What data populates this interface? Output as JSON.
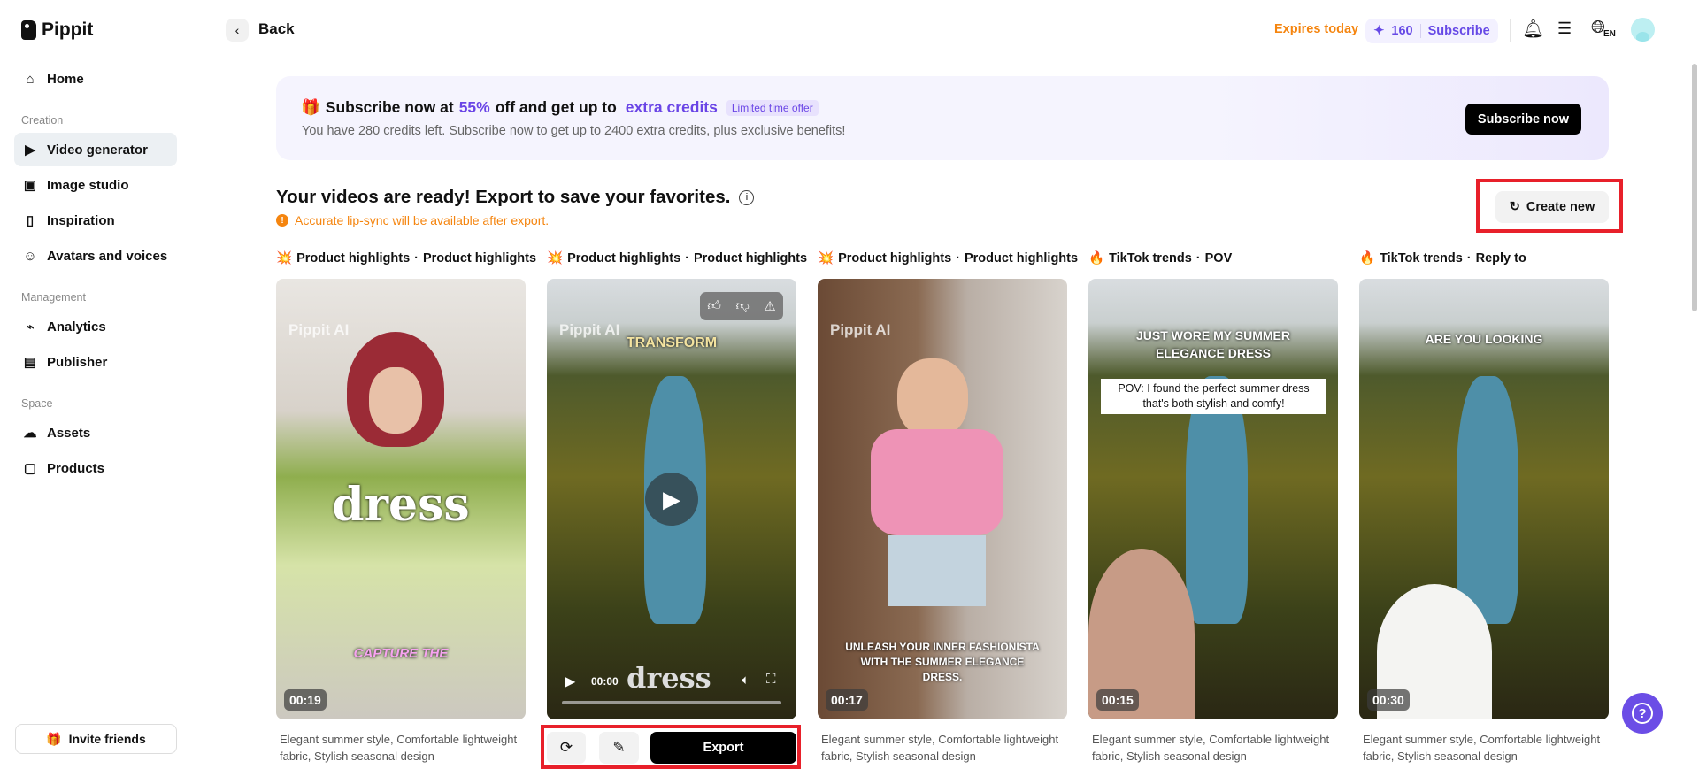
{
  "app": {
    "name": "Pippit"
  },
  "sidebar": {
    "home": "Home",
    "sections": [
      {
        "label": "Creation",
        "items": [
          {
            "label": "Video generator",
            "icon": "video-plus-icon",
            "active": true
          },
          {
            "label": "Image studio",
            "icon": "image-plus-icon"
          },
          {
            "label": "Inspiration",
            "icon": "inspiration-icon"
          },
          {
            "label": "Avatars and voices",
            "icon": "avatar-icon"
          }
        ]
      },
      {
        "label": "Management",
        "items": [
          {
            "label": "Analytics",
            "icon": "chart-icon"
          },
          {
            "label": "Publisher",
            "icon": "calendar-icon"
          }
        ]
      },
      {
        "label": "Space",
        "items": [
          {
            "label": "Assets",
            "icon": "cloud-icon"
          },
          {
            "label": "Products",
            "icon": "box-icon"
          }
        ]
      }
    ],
    "invite": "Invite friends"
  },
  "header": {
    "back": "Back",
    "expires": "Expires today",
    "credits": "160",
    "subscribe": "Subscribe",
    "lang": "EN"
  },
  "banner": {
    "t1": "Subscribe now at",
    "pct": "55%",
    "t2": "off and get up to",
    "extra": "extra credits",
    "badge": "Limited time offer",
    "sub": "You have 280 credits left. Subscribe now to get up to 2400 extra credits, plus exclusive benefits!",
    "button": "Subscribe now"
  },
  "main": {
    "heading": "Your videos are ready! Export to save your favorites.",
    "warning": "Accurate lip-sync will be available after export.",
    "create_new": "Create new"
  },
  "cards": [
    {
      "cat": "Product highlights",
      "sub": "Product highlights",
      "dur": "00:19",
      "caption": "dress",
      "caption2": "CAPTURE THE",
      "desc": "Elegant summer style, Comfortable lightweight fabric, Stylish seasonal design"
    },
    {
      "cat": "Product highlights",
      "sub": "Product highlights",
      "time": "00:00",
      "caption": "TRANSFORM",
      "caption2": "dress",
      "desc": ""
    },
    {
      "cat": "Product highlights",
      "sub": "Product highlights",
      "dur": "00:17",
      "caption": "UNLEASH YOUR INNER FASHIONISTA WITH THE SUMMER ELEGANCE DRESS.",
      "desc": "Elegant summer style, Comfortable lightweight fabric, Stylish seasonal design"
    },
    {
      "cat": "TikTok trends",
      "sub": "POV",
      "dur": "00:15",
      "caption": "JUST WORE MY SUMMER ELEGANCE DRESS",
      "caption2": "POV: I found the perfect summer dress that's both stylish and comfy!",
      "desc": "Elegant summer style, Comfortable lightweight fabric, Stylish seasonal design"
    },
    {
      "cat": "TikTok trends",
      "sub": "Reply to",
      "dur": "00:30",
      "caption": "ARE YOU LOOKING",
      "desc": "Elegant summer style, Comfortable lightweight fabric, Stylish seasonal design"
    }
  ],
  "watermark": "Pippit AI",
  "actions": {
    "export": "Export"
  },
  "colors": {
    "accent": "#6a45e6",
    "warning": "#f5850f",
    "highlight": "#e8202a"
  }
}
